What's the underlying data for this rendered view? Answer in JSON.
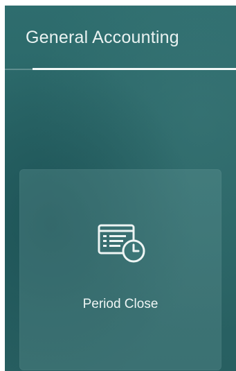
{
  "header": {
    "title": "General Accounting"
  },
  "tiles": [
    {
      "label": "Period Close",
      "icon": "period-close-icon"
    }
  ],
  "colors": {
    "panel": "#2b6768",
    "text": "#e9f2f1",
    "underline": "#f3f8f7"
  }
}
